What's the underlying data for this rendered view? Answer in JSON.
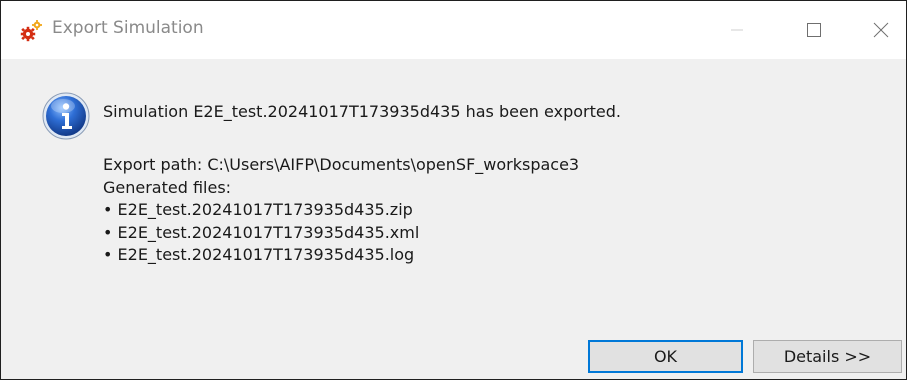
{
  "window": {
    "title": "Export Simulation",
    "controls": [
      "minimize",
      "maximize",
      "close"
    ]
  },
  "message": {
    "icon": "info-icon",
    "headline": "Simulation E2E_test.20241017T173935d435 has been exported.",
    "export_path": "Export path: C:\\Users\\AIFP\\Documents\\openSF_workspace3",
    "generated_label": "Generated files:",
    "files": [
      "• E2E_test.20241017T173935d435.zip",
      "• E2E_test.20241017T173935d435.xml",
      "• E2E_test.20241017T173935d435.log"
    ]
  },
  "buttons": {
    "ok": "OK",
    "details": "Details >>"
  },
  "colors": {
    "accent": "#0078d7",
    "body_bg": "#f0f0f0",
    "button_bg": "#e1e1e1"
  }
}
